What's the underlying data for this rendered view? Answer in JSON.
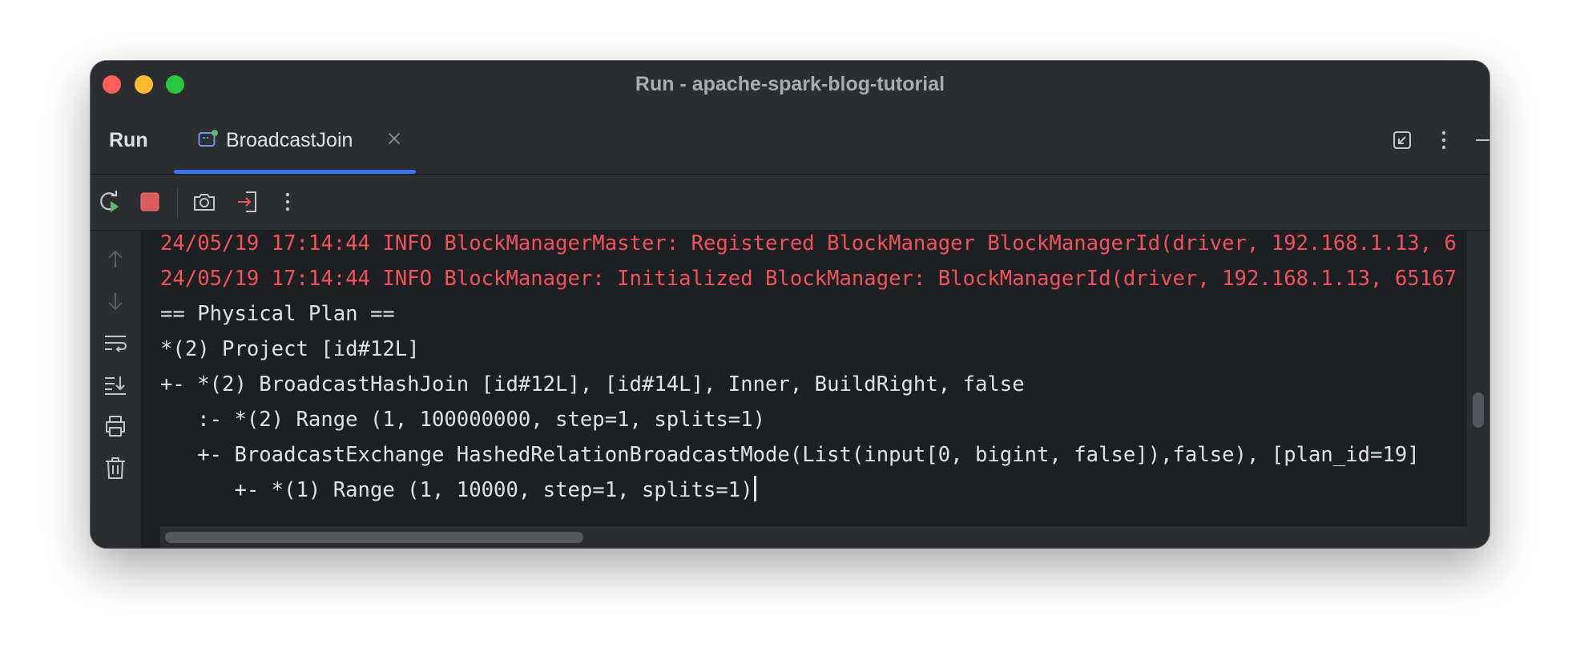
{
  "window": {
    "title": "Run - apache-spark-blog-tutorial"
  },
  "tool_window": {
    "title": "Run",
    "tab": {
      "label": "BroadcastJoin",
      "icon": "application-run-config-icon",
      "running_indicator_color": "#5fb86a",
      "active_underline_color": "#3574f0"
    },
    "actions": [
      "restore-icon",
      "more-vertical-icon",
      "minimize-icon"
    ]
  },
  "toolbar": {
    "buttons": [
      "rerun-icon",
      "stop-icon",
      "camera-icon",
      "exit-icon",
      "more-vertical-icon"
    ]
  },
  "gutter": {
    "buttons": [
      "arrow-up-icon",
      "arrow-down-icon",
      "soft-wrap-icon",
      "scroll-to-end-icon",
      "print-icon",
      "trash-icon"
    ]
  },
  "console": {
    "error_color": "#f0525b",
    "text_color": "#dfe1e5",
    "lines": [
      {
        "text": "24/05/19 17:14:44 INFO BlockManagerMaster: Registered BlockManager BlockManagerId(driver, 192.168.1.13, 6",
        "type": "err"
      },
      {
        "text": "24/05/19 17:14:44 INFO BlockManager: Initialized BlockManager: BlockManagerId(driver, 192.168.1.13, 65167",
        "type": "err"
      },
      {
        "text": "== Physical Plan ==",
        "type": "out"
      },
      {
        "text": "*(2) Project [id#12L]",
        "type": "out"
      },
      {
        "text": "+- *(2) BroadcastHashJoin [id#12L], [id#14L], Inner, BuildRight, false",
        "type": "out"
      },
      {
        "text": "   :- *(2) Range (1, 100000000, step=1, splits=1)",
        "type": "out"
      },
      {
        "text": "   +- BroadcastExchange HashedRelationBroadcastMode(List(input[0, bigint, false]),false), [plan_id=19]",
        "type": "out"
      },
      {
        "text": "      +- *(1) Range (1, 10000, step=1, splits=1)",
        "type": "out"
      }
    ]
  }
}
